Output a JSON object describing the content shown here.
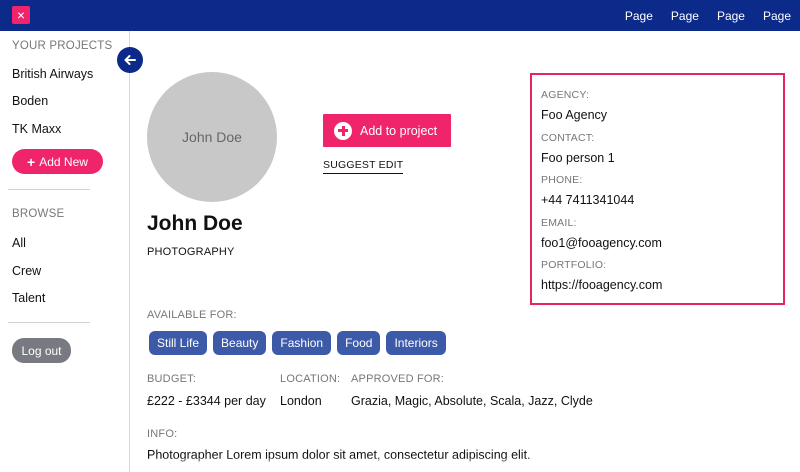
{
  "topbar": {
    "close_icon": "×",
    "nav": [
      "Page",
      "Page",
      "Page",
      "Page"
    ]
  },
  "sidebar": {
    "projects_heading": "YOUR PROJECTS",
    "projects": [
      "British Airways",
      "Boden",
      "TK Maxx"
    ],
    "add_new_label": "Add New",
    "browse_heading": "BROWSE",
    "browse": [
      "All",
      "Crew",
      "Talent"
    ],
    "logout_label": "Log out"
  },
  "profile": {
    "avatar_text": "John Doe",
    "add_project_label": "Add to project",
    "suggest_edit_label": "SUGGEST EDIT",
    "name": "John Doe",
    "profession": "PHOTOGRAPHY",
    "available_label": "AVAILABLE FOR:",
    "available_tags": [
      "Still Life",
      "Beauty",
      "Fashion",
      "Food",
      "Interiors"
    ],
    "budget_label": "BUDGET:",
    "budget_value": "£222 - £3344 per day",
    "location_label": "LOCATION:",
    "location_value": "London",
    "approved_label": "APPROVED FOR:",
    "approved_value": "Grazia, Magic, Absolute, Scala, Jazz, Clyde",
    "info_label": "INFO:",
    "info_text": "Photographer Lorem ipsum dolor sit amet, consectetur adipiscing elit."
  },
  "contact": {
    "agency_label": "AGENCY:",
    "agency_value": "Foo Agency",
    "contact_label": "CONTACT:",
    "contact_value": "Foo person 1",
    "phone_label": "PHONE:",
    "phone_value": "+44 7411341044",
    "email_label": "EMAIL:",
    "email_value": "foo1@fooagency.com",
    "portfolio_label": "PORTFOLIO:",
    "portfolio_value": "https://fooagency.com"
  },
  "colors": {
    "brand_navy": "#0b2a8a",
    "accent_pink": "#f0246b",
    "tag_blue": "#3d5aa8"
  }
}
